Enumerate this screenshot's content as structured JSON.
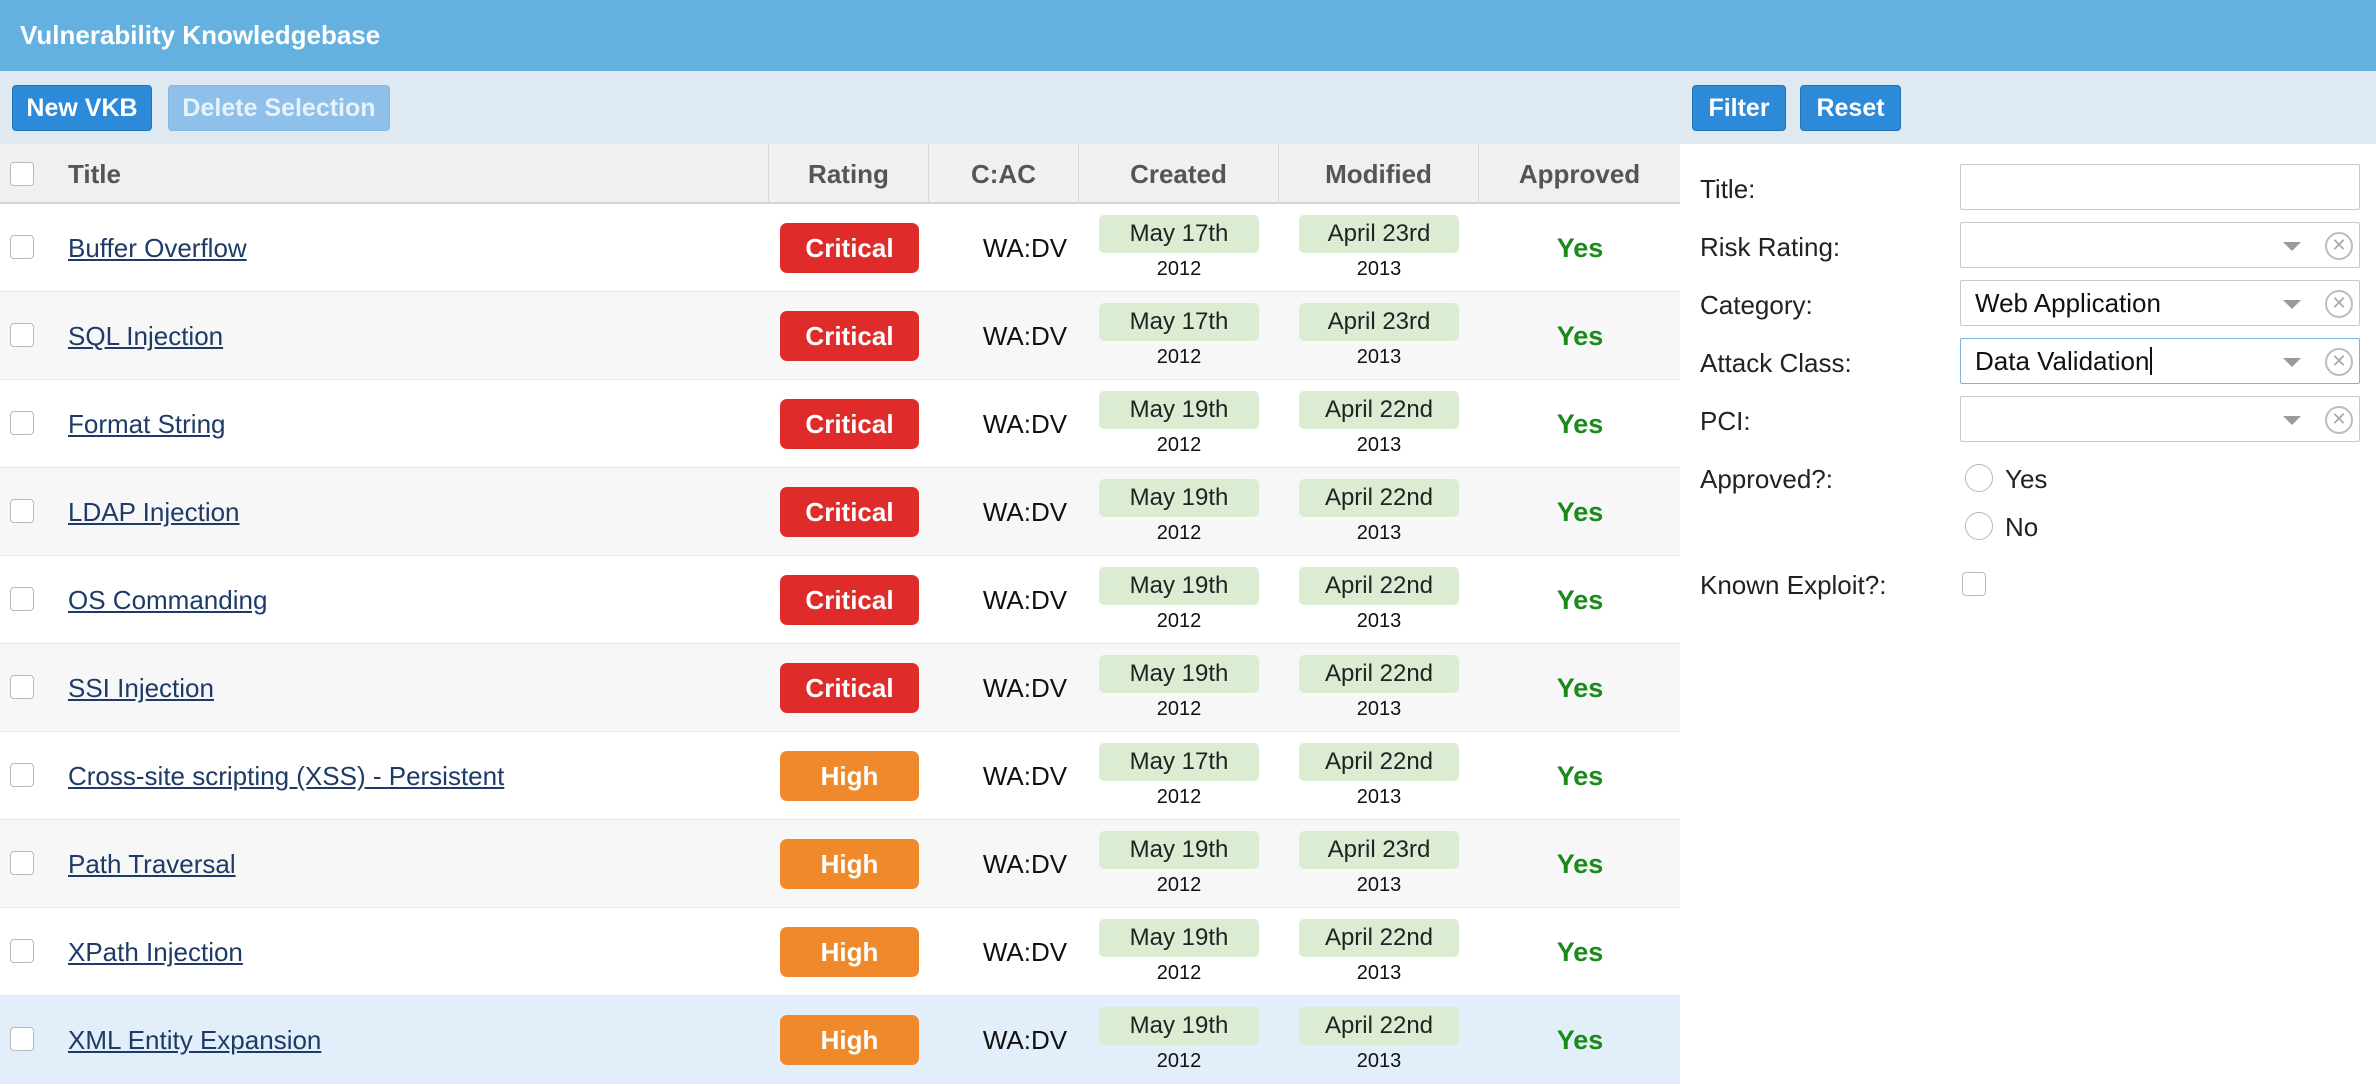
{
  "app": {
    "title": "Vulnerability Knowledgebase"
  },
  "toolbar": {
    "new_label": "New VKB",
    "delete_label": "Delete Selection",
    "filter_label": "Filter",
    "reset_label": "Reset"
  },
  "table": {
    "headers": {
      "title": "Title",
      "rating": "Rating",
      "cac": "C:AC",
      "created": "Created",
      "modified": "Modified",
      "approved": "Approved"
    },
    "rows": [
      {
        "title": "Buffer Overflow",
        "rating": "Critical",
        "cac": "WA:DV",
        "created_md": "May 17th",
        "created_y": "2012",
        "modified_md": "April 23rd",
        "modified_y": "2013",
        "approved": "Yes"
      },
      {
        "title": "SQL Injection",
        "rating": "Critical",
        "cac": "WA:DV",
        "created_md": "May 17th",
        "created_y": "2012",
        "modified_md": "April 23rd",
        "modified_y": "2013",
        "approved": "Yes"
      },
      {
        "title": "Format String",
        "rating": "Critical",
        "cac": "WA:DV",
        "created_md": "May 19th",
        "created_y": "2012",
        "modified_md": "April 22nd",
        "modified_y": "2013",
        "approved": "Yes"
      },
      {
        "title": "LDAP Injection",
        "rating": "Critical",
        "cac": "WA:DV",
        "created_md": "May 19th",
        "created_y": "2012",
        "modified_md": "April 22nd",
        "modified_y": "2013",
        "approved": "Yes"
      },
      {
        "title": "OS Commanding",
        "rating": "Critical",
        "cac": "WA:DV",
        "created_md": "May 19th",
        "created_y": "2012",
        "modified_md": "April 22nd",
        "modified_y": "2013",
        "approved": "Yes"
      },
      {
        "title": "SSI Injection",
        "rating": "Critical",
        "cac": "WA:DV",
        "created_md": "May 19th",
        "created_y": "2012",
        "modified_md": "April 22nd",
        "modified_y": "2013",
        "approved": "Yes"
      },
      {
        "title": "Cross-site scripting (XSS) - Persistent",
        "rating": "High",
        "cac": "WA:DV",
        "created_md": "May 17th",
        "created_y": "2012",
        "modified_md": "April 22nd",
        "modified_y": "2013",
        "approved": "Yes"
      },
      {
        "title": "Path Traversal",
        "rating": "High",
        "cac": "WA:DV",
        "created_md": "May 19th",
        "created_y": "2012",
        "modified_md": "April 23rd",
        "modified_y": "2013",
        "approved": "Yes"
      },
      {
        "title": "XPath Injection",
        "rating": "High",
        "cac": "WA:DV",
        "created_md": "May 19th",
        "created_y": "2012",
        "modified_md": "April 22nd",
        "modified_y": "2013",
        "approved": "Yes"
      },
      {
        "title": "XML Entity Expansion",
        "rating": "High",
        "cac": "WA:DV",
        "created_md": "May 19th",
        "created_y": "2012",
        "modified_md": "April 22nd",
        "modified_y": "2013",
        "approved": "Yes"
      }
    ]
  },
  "filters": {
    "title_label": "Title:",
    "title_value": "",
    "risk_label": "Risk Rating:",
    "risk_value": "",
    "category_label": "Category:",
    "category_value": "Web Application",
    "attack_label": "Attack Class:",
    "attack_value": "Data Validation",
    "pci_label": "PCI:",
    "pci_value": "",
    "approved_label": "Approved?:",
    "approved_yes": "Yes",
    "approved_no": "No",
    "exploit_label": "Known Exploit?:"
  },
  "colors": {
    "titlebar": "#64b1e0",
    "button": "#2d8ad8",
    "critical": "#e02b2b",
    "high": "#f0882c",
    "approved": "#1a8a1a",
    "date_chip": "#dcecd3"
  },
  "icons": {
    "dropdown": "chevron-down-icon",
    "clear": "clear-icon"
  }
}
